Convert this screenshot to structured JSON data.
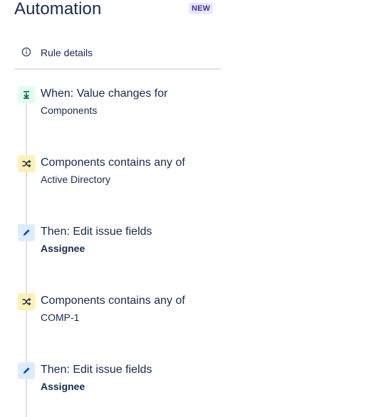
{
  "header": {
    "title": "Automation",
    "badge": "NEW"
  },
  "rule_details": {
    "label": "Rule details",
    "icon": "info-icon"
  },
  "steps": [
    {
      "kind": "trigger",
      "icon": "trigger-icon",
      "title": "When: Value changes for",
      "subtitle": "Components",
      "subtitle_bold": false
    },
    {
      "kind": "condition",
      "icon": "shuffle-icon",
      "title": "Components contains any of",
      "subtitle": "Active Directory",
      "subtitle_bold": false
    },
    {
      "kind": "action",
      "icon": "pencil-icon",
      "title": "Then: Edit issue fields",
      "subtitle": "Assignee",
      "subtitle_bold": true
    },
    {
      "kind": "condition",
      "icon": "shuffle-icon",
      "title": "Components contains any of",
      "subtitle": "COMP-1",
      "subtitle_bold": false
    },
    {
      "kind": "action",
      "icon": "pencil-icon",
      "title": "Then: Edit issue fields",
      "subtitle": "Assignee",
      "subtitle_bold": true
    }
  ],
  "colors": {
    "trigger": "#e3fcef",
    "condition": "#fff0b3",
    "action": "#deebff",
    "badge_bg": "#eae6ff",
    "badge_text": "#403294"
  }
}
